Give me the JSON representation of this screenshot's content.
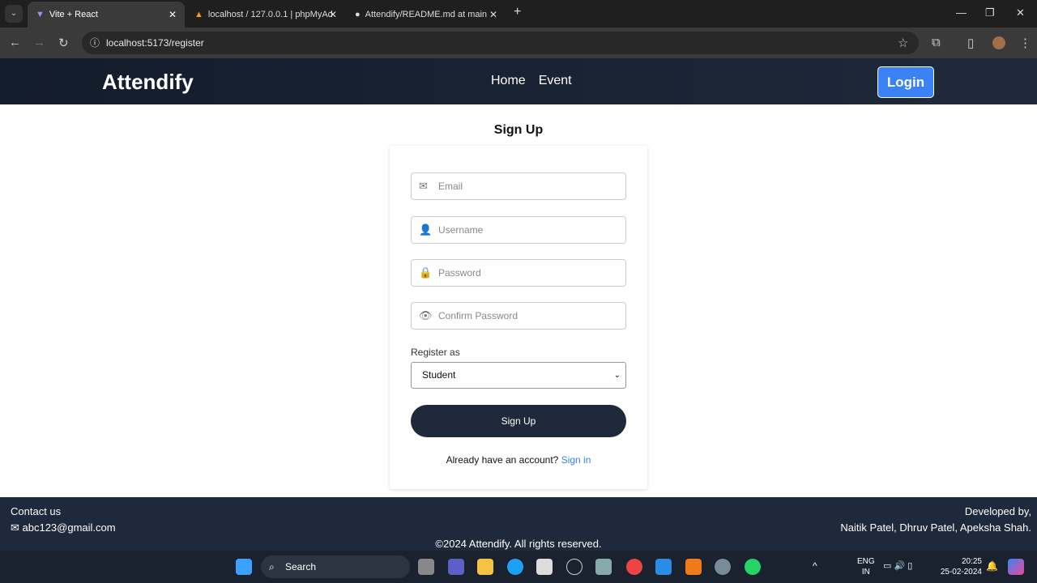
{
  "browser": {
    "tabs": [
      {
        "title": "Vite + React"
      },
      {
        "title": "localhost / 127.0.0.1 | phpMyAd"
      },
      {
        "title": "Attendify/README.md at main"
      }
    ],
    "url": "localhost:5173/register"
  },
  "header": {
    "brand": "Attendify",
    "nav": [
      "Home",
      "Event"
    ],
    "login": "Login"
  },
  "form": {
    "title": "Sign Up",
    "email_placeholder": "Email",
    "username_placeholder": "Username",
    "password_placeholder": "Password",
    "confirm_placeholder": "Confirm Password",
    "register_as_label": "Register as",
    "register_as_value": "Student",
    "submit": "Sign Up",
    "already_text": "Already have an account?",
    "signin_link": "Sign in"
  },
  "footer": {
    "contact_title": "Contact us",
    "email": "abc123@gmail.com",
    "copyright": "©2024 Attendify. All rights reserved.",
    "dev_title": "Developed by,",
    "developers": "Naitik Patel, Dhruv Patel, Apeksha Shah."
  },
  "taskbar": {
    "search": "Search",
    "lang1": "ENG",
    "lang2": "IN",
    "time": "20:25",
    "date": "25-02-2024"
  }
}
